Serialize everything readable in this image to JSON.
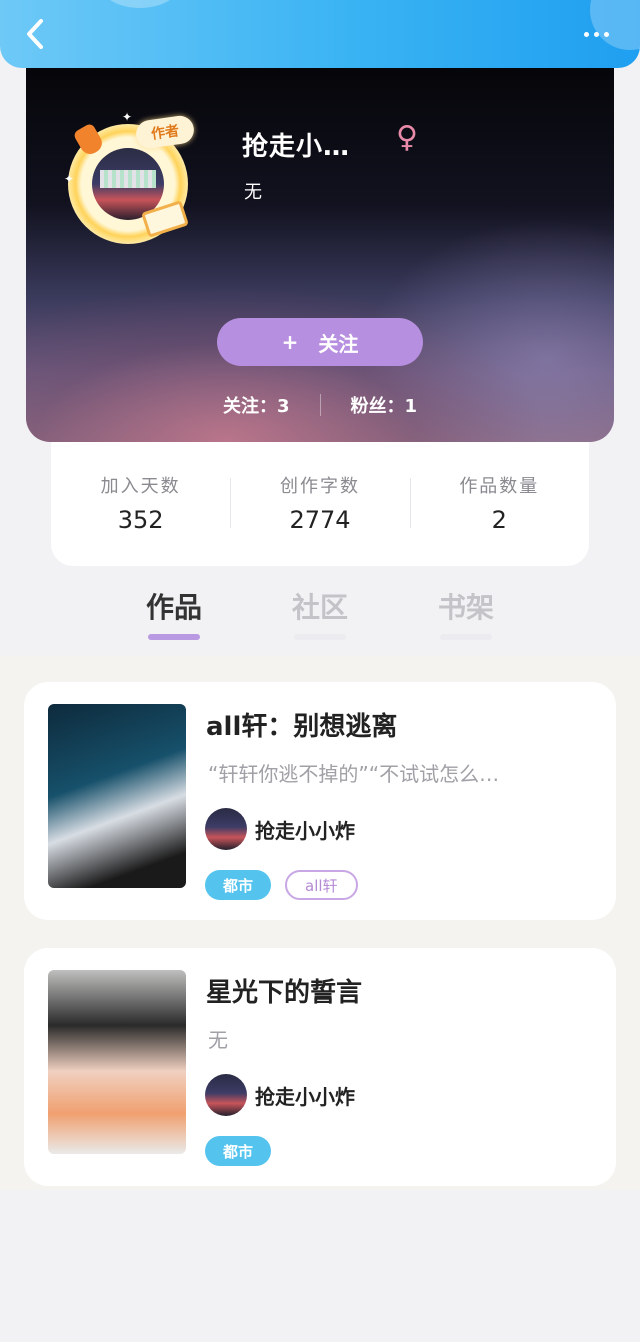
{
  "header": {
    "back_icon": "chevron-left-icon",
    "more_icon": "more-dots-icon"
  },
  "profile": {
    "badge": "作者",
    "username": "抢走小…",
    "gender_symbol": "♀",
    "bio": "无",
    "follow_button": "关注",
    "follow_plus": "+",
    "following_label": "关注：3",
    "fans_label": "粉丝：1"
  },
  "stats": [
    {
      "label": "加入天数",
      "value": "352"
    },
    {
      "label": "创作字数",
      "value": "2774"
    },
    {
      "label": "作品数量",
      "value": "2"
    }
  ],
  "tabs": [
    {
      "label": "作品",
      "active": true
    },
    {
      "label": "社区",
      "active": false
    },
    {
      "label": "书架",
      "active": false
    }
  ],
  "works": [
    {
      "title": "all轩：别想逃离",
      "description": "“轩轩你逃不掉的”“不试试怎么…",
      "author": "抢走小小炸",
      "tags": [
        "都市",
        "all轩"
      ]
    },
    {
      "title": "星光下的誓言",
      "description": "无",
      "author": "抢走小小炸",
      "tags": [
        "都市"
      ]
    }
  ],
  "colors": {
    "header_blue": "#3ab3f3",
    "follow_purple": "#b78fe0",
    "tab_indicator": "#b99ae2",
    "genre_tag": "#54c4ee",
    "gender_pink": "#e88aa8"
  }
}
